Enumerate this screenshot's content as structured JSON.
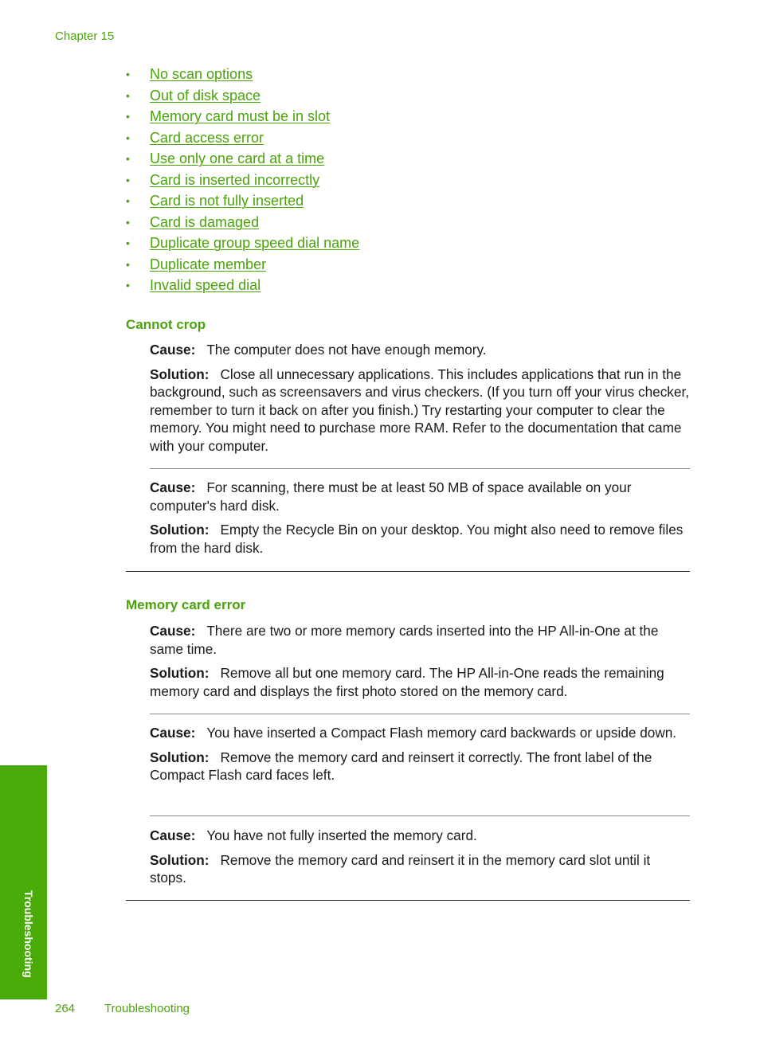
{
  "header": {
    "chapter": "Chapter 15"
  },
  "toc_links": [
    "No scan options",
    "Out of disk space",
    "Memory card must be in slot",
    "Card access error",
    "Use only one card at a time",
    "Card is inserted incorrectly",
    "Card is not fully inserted",
    "Card is damaged",
    "Duplicate group speed dial name",
    "Duplicate member",
    "Invalid speed dial"
  ],
  "bullet": "•",
  "labels": {
    "cause": "Cause:",
    "solution": "Solution:"
  },
  "sections": [
    {
      "title": "Cannot crop",
      "entries": [
        {
          "cause": "The computer does not have enough memory.",
          "solution": "Close all unnecessary applications. This includes applications that run in the background, such as screensavers and virus checkers. (If you turn off your virus checker, remember to turn it back on after you finish.) Try restarting your computer to clear the memory. You might need to purchase more RAM. Refer to the documentation that came with your computer."
        },
        {
          "cause": "For scanning, there must be at least 50 MB of space available on your computer's hard disk.",
          "solution": "Empty the Recycle Bin on your desktop. You might also need to remove files from the hard disk."
        }
      ]
    },
    {
      "title": "Memory card error",
      "entries": [
        {
          "cause": "There are two or more memory cards inserted into the HP All-in-One at the same time.",
          "solution": "Remove all but one memory card. The HP All-in-One reads the remaining memory card and displays the first photo stored on the memory card."
        },
        {
          "cause": "You have inserted a Compact Flash memory card backwards or upside down.",
          "solution": "Remove the memory card and reinsert it correctly. The front label of the Compact Flash card faces left."
        },
        {
          "cause": "You have not fully inserted the memory card.",
          "solution": "Remove the memory card and reinsert it in the memory card slot until it stops."
        }
      ]
    }
  ],
  "side_tab": {
    "label": "Troubleshooting",
    "color": "#4aaa08"
  },
  "footer": {
    "page_number": "264",
    "section": "Troubleshooting"
  },
  "colors": {
    "accent": "#4aa30a",
    "text": "#1a1a1a"
  }
}
